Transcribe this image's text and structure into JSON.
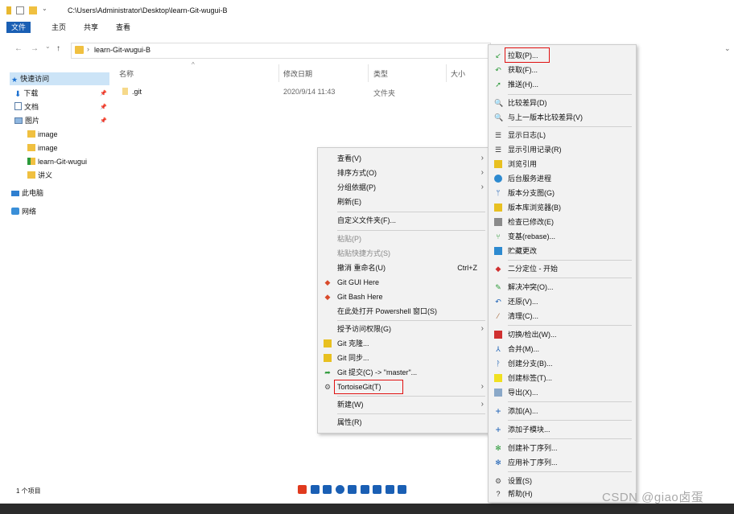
{
  "title_bar": {
    "path": "C:\\Users\\Administrator\\Desktop\\learn-Git-wugui-B"
  },
  "ribbon": {
    "tabs": [
      "文件",
      "主页",
      "共享",
      "查看"
    ]
  },
  "address": {
    "crumb": "learn-Git-wugui-B",
    "back": "←",
    "forward": "→",
    "recent": "⌄",
    "up": "↑",
    "sep": "›"
  },
  "navpane": {
    "items": [
      {
        "label": "快速访问",
        "icon": "star-icon"
      },
      {
        "label": "下载",
        "icon": "download-icon",
        "pinned": true
      },
      {
        "label": "文档",
        "icon": "document-icon",
        "pinned": true
      },
      {
        "label": "图片",
        "icon": "picture-icon",
        "pinned": true
      },
      {
        "label": "image",
        "icon": "folder-icon"
      },
      {
        "label": "image",
        "icon": "folder-icon"
      },
      {
        "label": "learn-Git-wugui",
        "icon": "git-folder-icon"
      },
      {
        "label": "讲义",
        "icon": "folder-icon"
      },
      {
        "label": "此电脑",
        "icon": "computer-icon"
      },
      {
        "label": "网络",
        "icon": "network-icon"
      }
    ],
    "pin_glyph": "📌"
  },
  "filelist": {
    "columns": [
      "名称",
      "修改日期",
      "类型",
      "大小"
    ],
    "sort_arrow": "^",
    "rows": [
      {
        "name": ".git",
        "date": "2020/9/14 11:43",
        "type": "文件夹",
        "size": ""
      }
    ]
  },
  "status": {
    "count": "1 个项目"
  },
  "context_menu": {
    "items": [
      {
        "label": "查看(V)",
        "submenu": true
      },
      {
        "label": "排序方式(O)",
        "submenu": true
      },
      {
        "label": "分组依据(P)",
        "submenu": true
      },
      {
        "label": "刷新(E)"
      },
      {
        "label": "自定义文件夹(F)..."
      },
      {
        "label": "粘贴(P)",
        "disabled": true
      },
      {
        "label": "粘贴快捷方式(S)",
        "disabled": true
      },
      {
        "label": "撤消 重命名(U)",
        "shortcut": "Ctrl+Z"
      },
      {
        "label": "Git GUI Here",
        "icon": "git-gui-icon"
      },
      {
        "label": "Git Bash Here",
        "icon": "git-bash-icon"
      },
      {
        "label": "在此处打开 Powershell 窗口(S)"
      },
      {
        "label": "授予访问权限(G)",
        "submenu": true
      },
      {
        "label": "Git 克隆...",
        "icon": "git-clone-icon"
      },
      {
        "label": "Git 同步...",
        "icon": "git-sync-icon"
      },
      {
        "label": "Git 提交(C) -> \"master\"...",
        "icon": "git-commit-icon"
      },
      {
        "label": "TortoiseGit(T)",
        "icon": "tortoisegit-icon",
        "submenu": true,
        "highlighted": true
      },
      {
        "label": "新建(W)",
        "submenu": true
      },
      {
        "label": "属性(R)"
      }
    ],
    "arrow_glyph": "›"
  },
  "tortoise_menu": {
    "items": [
      {
        "label": "拉取(P)...",
        "icon": "pull-icon",
        "highlighted": true
      },
      {
        "label": "获取(F)...",
        "icon": "fetch-icon"
      },
      {
        "label": "推送(H)...",
        "icon": "push-icon"
      },
      {
        "label": "比较差异(D)",
        "icon": "diff-icon"
      },
      {
        "label": "与上一版本比较差异(V)",
        "icon": "diff-previous-icon"
      },
      {
        "label": "显示日志(L)",
        "icon": "log-icon"
      },
      {
        "label": "显示引用记录(R)",
        "icon": "reflog-icon"
      },
      {
        "label": "浏览引用",
        "icon": "browse-references-icon"
      },
      {
        "label": "后台服务进程",
        "icon": "daemon-icon"
      },
      {
        "label": "版本分支图(G)",
        "icon": "revision-graph-icon"
      },
      {
        "label": "版本库浏览器(B)",
        "icon": "repo-browser-icon"
      },
      {
        "label": "检查已修改(E)",
        "icon": "check-modifications-icon"
      },
      {
        "label": "变基(rebase)...",
        "icon": "rebase-icon"
      },
      {
        "label": "贮藏更改",
        "icon": "stash-icon"
      },
      {
        "label": "二分定位 - 开始",
        "icon": "bisect-icon"
      },
      {
        "label": "解决冲突(O)...",
        "icon": "resolve-icon"
      },
      {
        "label": "还原(V)...",
        "icon": "revert-icon"
      },
      {
        "label": "清理(C)...",
        "icon": "cleanup-icon"
      },
      {
        "label": "切换/检出(W)...",
        "icon": "switch-icon"
      },
      {
        "label": "合并(M)...",
        "icon": "merge-icon"
      },
      {
        "label": "创建分支(B)...",
        "icon": "branch-icon"
      },
      {
        "label": "创建标签(T)...",
        "icon": "tag-icon"
      },
      {
        "label": "导出(X)...",
        "icon": "export-icon"
      },
      {
        "label": "添加(A)...",
        "icon": "add-icon"
      },
      {
        "label": "添加子模块...",
        "icon": "add-submodule-icon"
      },
      {
        "label": "创建补丁序列...",
        "icon": "create-patch-icon"
      },
      {
        "label": "应用补丁序列...",
        "icon": "apply-patch-icon"
      },
      {
        "label": "设置(S)",
        "icon": "settings-icon"
      },
      {
        "label": "帮助(H)",
        "icon": "help-icon"
      }
    ]
  },
  "watermark": "CSDN @giao卤蛋",
  "colors": {
    "accent": "#1a5fb4",
    "highlight_box": "#e01010",
    "selection": "#cce4f7"
  }
}
